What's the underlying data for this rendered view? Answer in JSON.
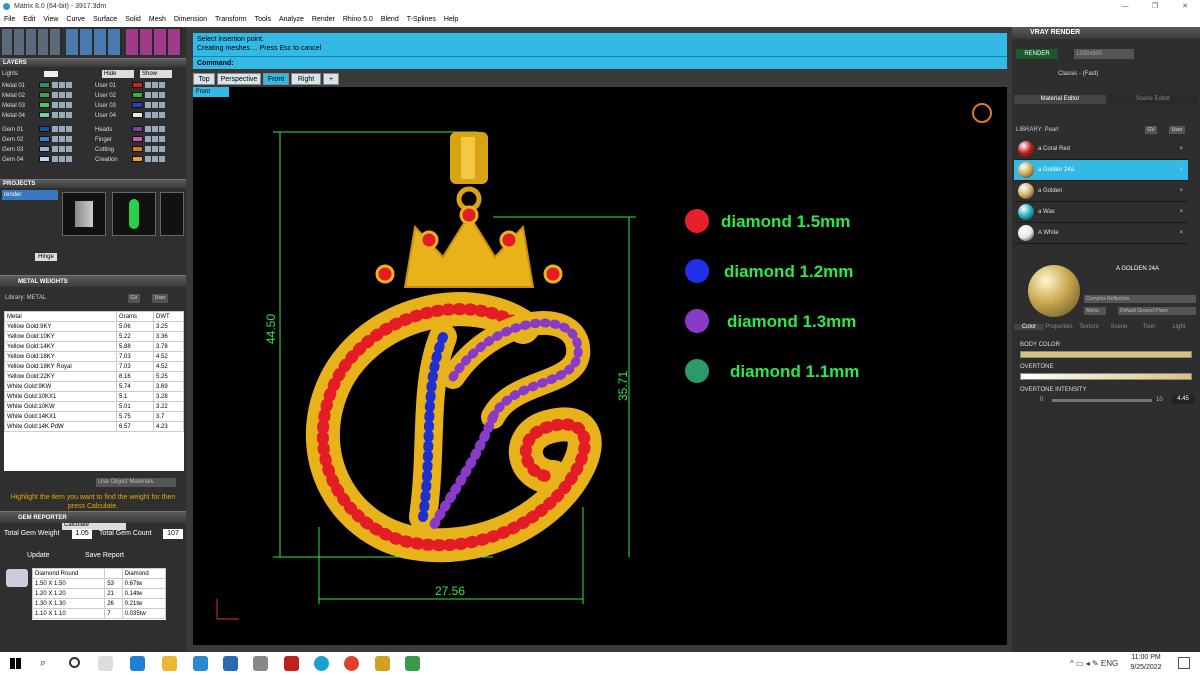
{
  "window": {
    "title": "Matrix 8.0 (64-bit) - 3917.3dm"
  },
  "menu": [
    "File",
    "Edit",
    "View",
    "Curve",
    "Surface",
    "Solid",
    "Mesh",
    "Dimension",
    "Transform",
    "Tools",
    "Analyze",
    "Render",
    "Rhino 5.0",
    "Blend",
    "T-Splines",
    "Help"
  ],
  "layers": {
    "title": "LAYERS",
    "lights": "Lights",
    "hide": "Hide",
    "show": "Show",
    "left": [
      {
        "name": "Metal 01",
        "color": "#2d8f5a"
      },
      {
        "name": "Metal 02",
        "color": "#3aa84a"
      },
      {
        "name": "Metal 03",
        "color": "#4cc75a"
      },
      {
        "name": "Metal 04",
        "color": "#6fd3b0"
      },
      {
        "name": "Gem 01",
        "color": "#1b4fa8"
      },
      {
        "name": "Gem 02",
        "color": "#3a7fd0"
      },
      {
        "name": "Gem 03",
        "color": "#8fb8e0"
      },
      {
        "name": "Gem 04",
        "color": "#c0d8f0"
      }
    ],
    "right": [
      {
        "name": "User 01",
        "color": "#d02020"
      },
      {
        "name": "User 02",
        "color": "#38b038"
      },
      {
        "name": "User 03",
        "color": "#2040d0"
      },
      {
        "name": "User 04",
        "color": "#e8e8e8"
      },
      {
        "name": "Heads",
        "color": "#8040a0"
      },
      {
        "name": "Finger",
        "color": "#c060a0"
      },
      {
        "name": "Cutting",
        "color": "#e07020"
      },
      {
        "name": "Creation",
        "color": "#e8a030"
      }
    ]
  },
  "projects": {
    "title": "PROJECTS",
    "item": "render",
    "hinge": "Hinge"
  },
  "metal_weights": {
    "title": "METAL WEIGHTS",
    "library": "Library: METAL",
    "gv": "GV",
    "user": "User",
    "headers": [
      "Metal",
      "Grams",
      "DWT"
    ],
    "rows": [
      [
        "Yellow Gold:9KY",
        "5.06",
        "3.25"
      ],
      [
        "Yellow Gold:10KY",
        "5.22",
        "3.36"
      ],
      [
        "Yellow Gold:14KY",
        "5.88",
        "3.78"
      ],
      [
        "Yellow Gold:18KY",
        "7.03",
        "4.52"
      ],
      [
        "Yellow Gold:18KY Royal",
        "7.03",
        "4.52"
      ],
      [
        "Yellow Gold:22KY",
        "8.16",
        "5.25"
      ],
      [
        "White Gold:9KW",
        "5.74",
        "3.69"
      ],
      [
        "White Gold:10KX1",
        "5.1",
        "3.28"
      ],
      [
        "White Gold:10KW",
        "5.01",
        "3.22"
      ],
      [
        "White Gold:14KX1",
        "5.75",
        "3.7"
      ],
      [
        "White Gold:14K PdW",
        "6.57",
        "4.23"
      ]
    ],
    "use_object": "Use Object Materials",
    "hint": "Highlight the item you want to find the weight for then press Calculate.",
    "calculate": "Calculate"
  },
  "gem_reporter": {
    "title": "GEM REPORTER",
    "total_weight_label": "Total Gem Weight",
    "total_weight": "1.05",
    "total_count_label": "Total Gem Count",
    "total_count": "107",
    "update": "Update",
    "save": "Save Report",
    "headers": [
      "Diamond Round",
      "",
      "Diamond"
    ],
    "rows": [
      [
        "1.50 X 1.50",
        "53",
        "0.67tw"
      ],
      [
        "1.20 X 1.20",
        "21",
        "0.14tw"
      ],
      [
        "1.30 X 1.30",
        "26",
        "0.21tw"
      ],
      [
        "1.10 X 1.10",
        "7",
        "0.035tw"
      ]
    ]
  },
  "prompt": {
    "line1": "Select insertion point.",
    "line2": "Creating meshes ... Press Esc to cancel",
    "command": "Command:"
  },
  "tabs": [
    "Top",
    "Perspective",
    "Front",
    "Right",
    "+"
  ],
  "active_tab": "Front",
  "viewport": {
    "label": "Front",
    "legend": [
      {
        "text": "diamond 1.5mm",
        "color": "#e8202a"
      },
      {
        "text": "diamond 1.2mm",
        "color": "#2030e8"
      },
      {
        "text": "diamond 1.3mm",
        "color": "#8a3ac8"
      },
      {
        "text": "diamond 1.1mm",
        "color": "#2a9a6a"
      }
    ],
    "dims": {
      "height": "44.50",
      "inner_height": "35.71",
      "width": "27.56"
    }
  },
  "vray": {
    "title": "VRAY RENDER",
    "render": "RENDER",
    "size": "1200x900",
    "style": "Classic - (Fast)",
    "tab1": "Material Editor",
    "tab2": "Scene Editor",
    "library": "LIBRARY: Pearl",
    "gv": "GV",
    "user": "User",
    "materials": [
      {
        "name": "a Coral Red",
        "color": "#c01818"
      },
      {
        "name": "a Golden 24a",
        "color": "#c8a850"
      },
      {
        "name": "a Golden",
        "color": "#d0b060"
      },
      {
        "name": "a Wax",
        "color": "#20b0b8"
      },
      {
        "name": "A White",
        "color": "#e8e8e8"
      }
    ],
    "selected_material": "A GOLDEN 24A",
    "reflection": "Complex Reflection",
    "alpha": "Alpha",
    "ground": "Default Ground Plane",
    "subtabs": [
      "Color",
      "Properties",
      "Texture",
      "Scene",
      "Toon",
      "Light"
    ],
    "body_color": "BODY COLOR",
    "overtone": "OVERTONE",
    "overtone_intensity": "OVERTONE INTENSITY",
    "intensity_min": "0",
    "intensity_max": "10",
    "intensity_val": "4.45"
  },
  "taskbar": {
    "time": "11:00 PM",
    "date": "9/25/2022"
  }
}
